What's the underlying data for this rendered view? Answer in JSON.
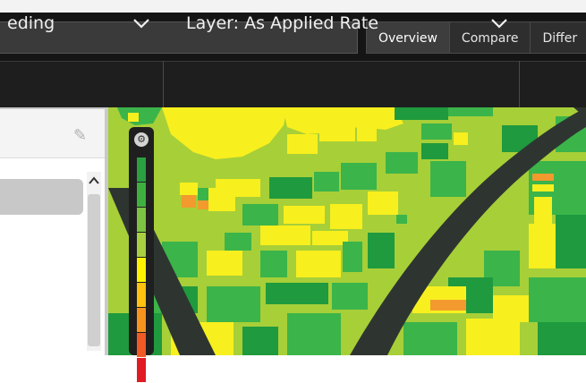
{
  "toolbar": {
    "tabs": [
      {
        "label": "Overview",
        "active": true
      },
      {
        "label": "Compare",
        "active": false
      },
      {
        "label": "Differ",
        "active": false
      }
    ]
  },
  "selectors": {
    "operation_label": "eding",
    "layer_label": "Layer: As Applied Rate"
  },
  "legend": {
    "colors": [
      "#2aa040",
      "#3fb040",
      "#7dc242",
      "#a8d040",
      "#fff200",
      "#ffc20e",
      "#f7941d",
      "#f15a24",
      "#e01b24"
    ]
  },
  "colors": {
    "dark_green": "#1f9a3e",
    "green": "#3bb44a",
    "light_green": "#a7cf38",
    "yellow": "#f8ef1e",
    "orange": "#f29a2e",
    "red": "#e02020",
    "road": "#2e3530"
  }
}
